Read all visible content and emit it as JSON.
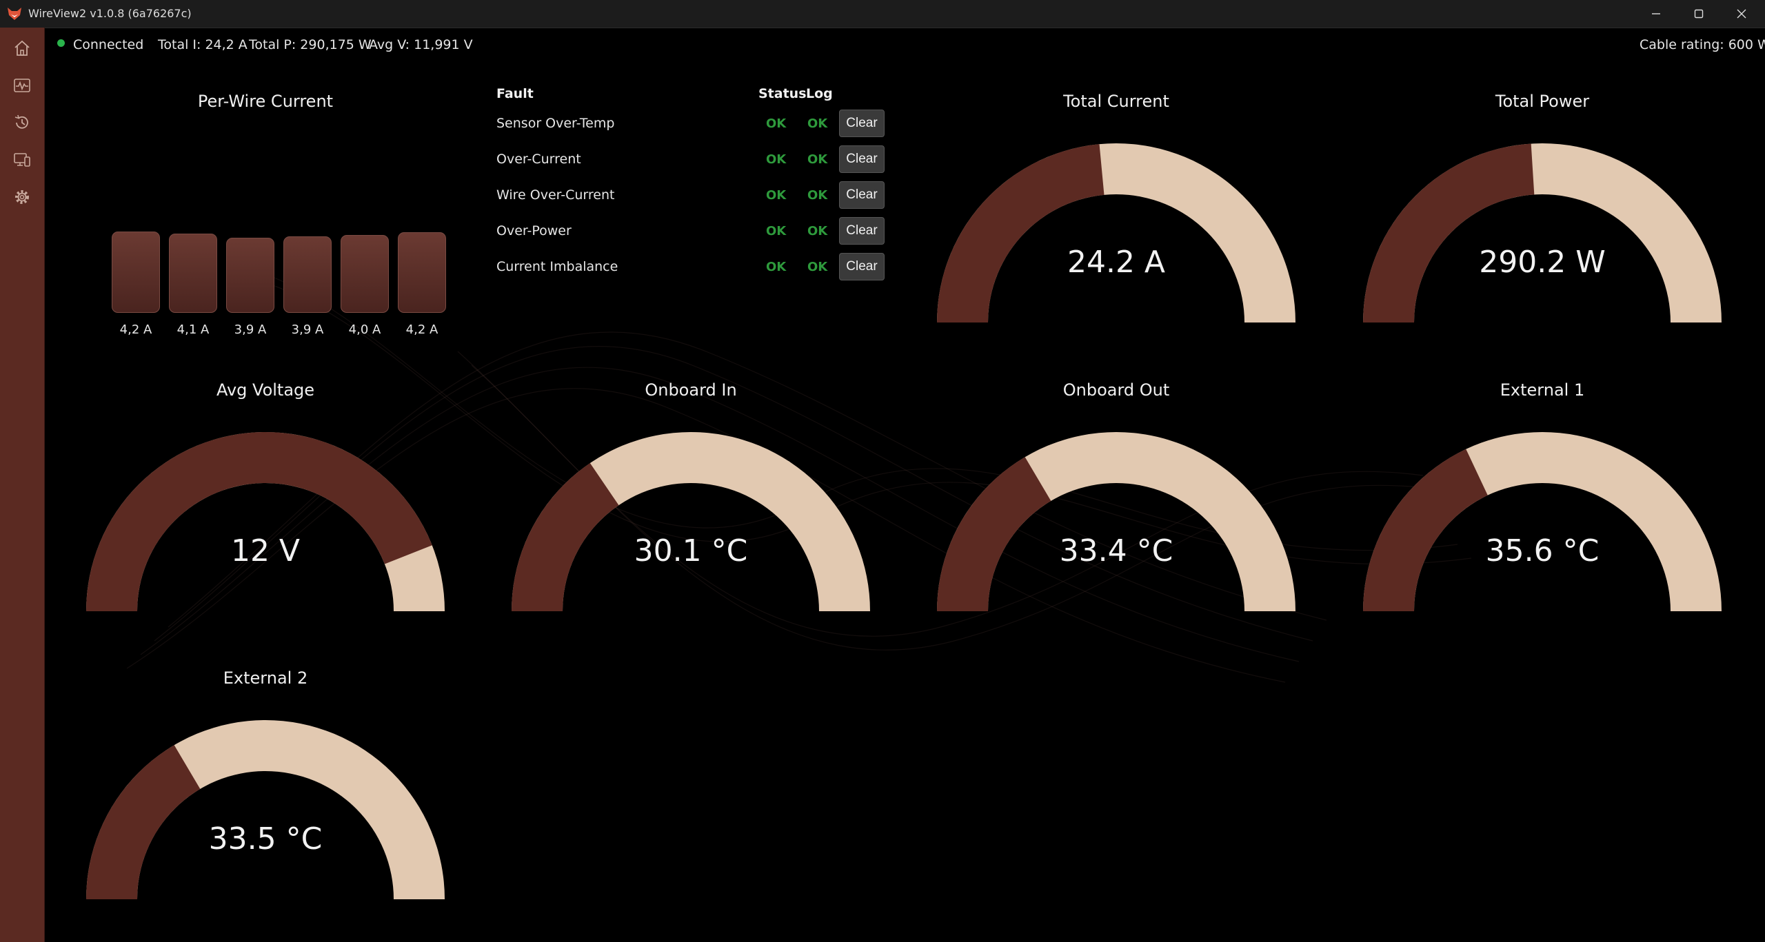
{
  "window": {
    "title": "WireView2 v1.0.8 (6a76267c)",
    "controls": [
      "minimize-icon",
      "maximize-icon",
      "close-icon"
    ]
  },
  "sidebar": {
    "items": [
      {
        "name": "home",
        "icon": "home-icon"
      },
      {
        "name": "monitor",
        "icon": "waveform-icon"
      },
      {
        "name": "history",
        "icon": "history-icon"
      },
      {
        "name": "devices",
        "icon": "devices-icon"
      },
      {
        "name": "settings",
        "icon": "gear-icon"
      }
    ]
  },
  "status": {
    "connection": "Connected",
    "total_current": "Total I: 24,2 A",
    "total_power": "Total P: 290,175 W",
    "avg_voltage": "Avg V: 11,991 V",
    "cable_rating": "Cable rating: 600 W"
  },
  "colors": {
    "accent": "#5c2a22",
    "track": "#e2c9b1",
    "sidebar": "#5b2a22",
    "ok": "#2e9a3c",
    "connected": "#2ab34b"
  },
  "per_wire": {
    "title": "Per-Wire Current",
    "wires": [
      {
        "label": "4,2 A",
        "value": 4.2
      },
      {
        "label": "4,1 A",
        "value": 4.1
      },
      {
        "label": "3,9 A",
        "value": 3.9
      },
      {
        "label": "3,9 A",
        "value": 3.9
      },
      {
        "label": "4,0 A",
        "value": 4.0
      },
      {
        "label": "4,2 A",
        "value": 4.2
      }
    ]
  },
  "faults": {
    "headers": {
      "fault": "Fault",
      "status": "Status",
      "log": "Log"
    },
    "clear_label": "Clear",
    "rows": [
      {
        "name": "Sensor Over-Temp",
        "status": "OK",
        "log": "OK"
      },
      {
        "name": "Over-Current",
        "status": "OK",
        "log": "OK"
      },
      {
        "name": "Wire Over-Current",
        "status": "OK",
        "log": "OK"
      },
      {
        "name": "Over-Power",
        "status": "OK",
        "log": "OK"
      },
      {
        "name": "Current Imbalance",
        "status": "OK",
        "log": "OK"
      }
    ]
  },
  "gauges": [
    {
      "title": "Total Current",
      "value": "24.2 A",
      "fraction": 0.47
    },
    {
      "title": "Total Power",
      "value": "290.2 W",
      "fraction": 0.48
    },
    {
      "title": "Avg Voltage",
      "value": "12 V",
      "fraction": 0.88
    },
    {
      "title": "Onboard In",
      "value": "30.1 °C",
      "fraction": 0.31
    },
    {
      "title": "Onboard Out",
      "value": "33.4 °C",
      "fraction": 0.33
    },
    {
      "title": "External 1",
      "value": "35.6 °C",
      "fraction": 0.36
    },
    {
      "title": "External 2",
      "value": "33.5 °C",
      "fraction": 0.33
    }
  ]
}
